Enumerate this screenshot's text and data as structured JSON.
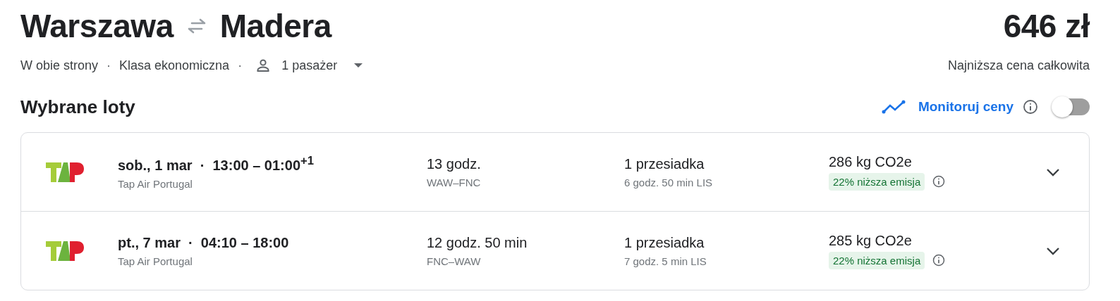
{
  "header": {
    "origin": "Warszawa",
    "destination": "Madera",
    "price": "646 zł",
    "price_note": "Najniższa cena całkowita"
  },
  "options": {
    "trip_type": "W obie strony",
    "separators": [
      "·",
      "·"
    ],
    "cabin_class": "Klasa ekonomiczna",
    "passengers": "1 pasażer"
  },
  "section_title": "Wybrane loty",
  "price_tracking": {
    "label": "Monitoruj ceny",
    "on": false
  },
  "flights": [
    {
      "times": "sob., 1 mar  ·  13:00 – 01:00$^{+1}$",
      "airline": "Tap Air Portugal",
      "duration": "13 godz.",
      "route": "WAW–FNC",
      "stops": "1 przesiadka",
      "layover": "6 godz. 50 min LIS",
      "emissions": "286 kg CO2e",
      "emission_badge": "22% niższa emisja",
      "expanded": false
    },
    {
      "times": "pt., 7 mar  ·  04:10 – 18:00",
      "airline": "Tap Air Portugal",
      "duration": "12 godz. 50 min",
      "route": "FNC–WAW",
      "stops": "1 przesiadka",
      "layover": "7 godz. 5 min LIS",
      "emissions": "285 kg CO2e",
      "emission_badge": "22% niższa emisja",
      "expanded": false
    }
  ]
}
